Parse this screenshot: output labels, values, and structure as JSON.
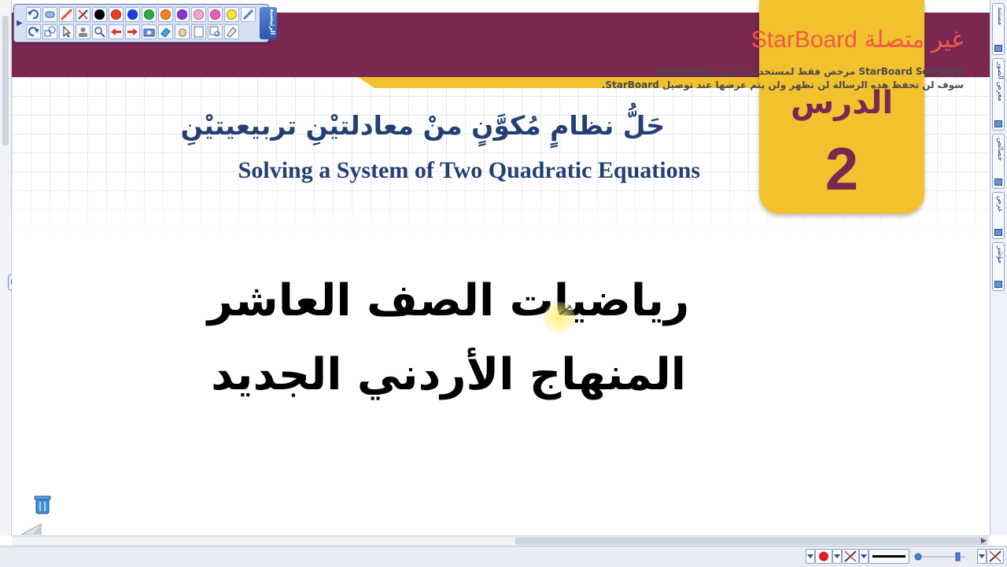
{
  "lesson": {
    "label": "الدرس",
    "number": "2",
    "title_ar": "حَلُّ نظامٍ مُكوَّنٍ منْ معادلتيْنِ تربيعيتيْنِ",
    "title_en": "Solving a System of Two Quadratic Equations"
  },
  "watermark": {
    "title": "غير متصلة StarBoard",
    "line1": "StarBoard Software مرخص فقط لمستخدمي أجهزة StarBoard.",
    "line2": "سوف لن تحفظ هذه الرسالة لن تظهر ولن يتم عرضها عند توصيل StarBoard."
  },
  "body": {
    "line1": "رياضيات الصف العاشر",
    "line2": "المنهاج الأردني الجديد"
  },
  "toolbar": {
    "main_label": "الرئيسية",
    "pen_colors": [
      "#000000",
      "#f03a1e",
      "#1c3ee0",
      "#26b044",
      "#f5821f",
      "#8f2fd1",
      "#f7a3c9",
      "#f25ab8",
      "#f5e63a"
    ]
  },
  "sidebar": {
    "tabs": [
      "مستند",
      "معرض الصور",
      "خصائص",
      "عرض",
      "مؤشر"
    ]
  },
  "colors": {
    "header_band": "#7a2752",
    "accent_yellow": "#f2c12e",
    "title_blue": "#233f74",
    "watermark_red": "#f05a45"
  }
}
